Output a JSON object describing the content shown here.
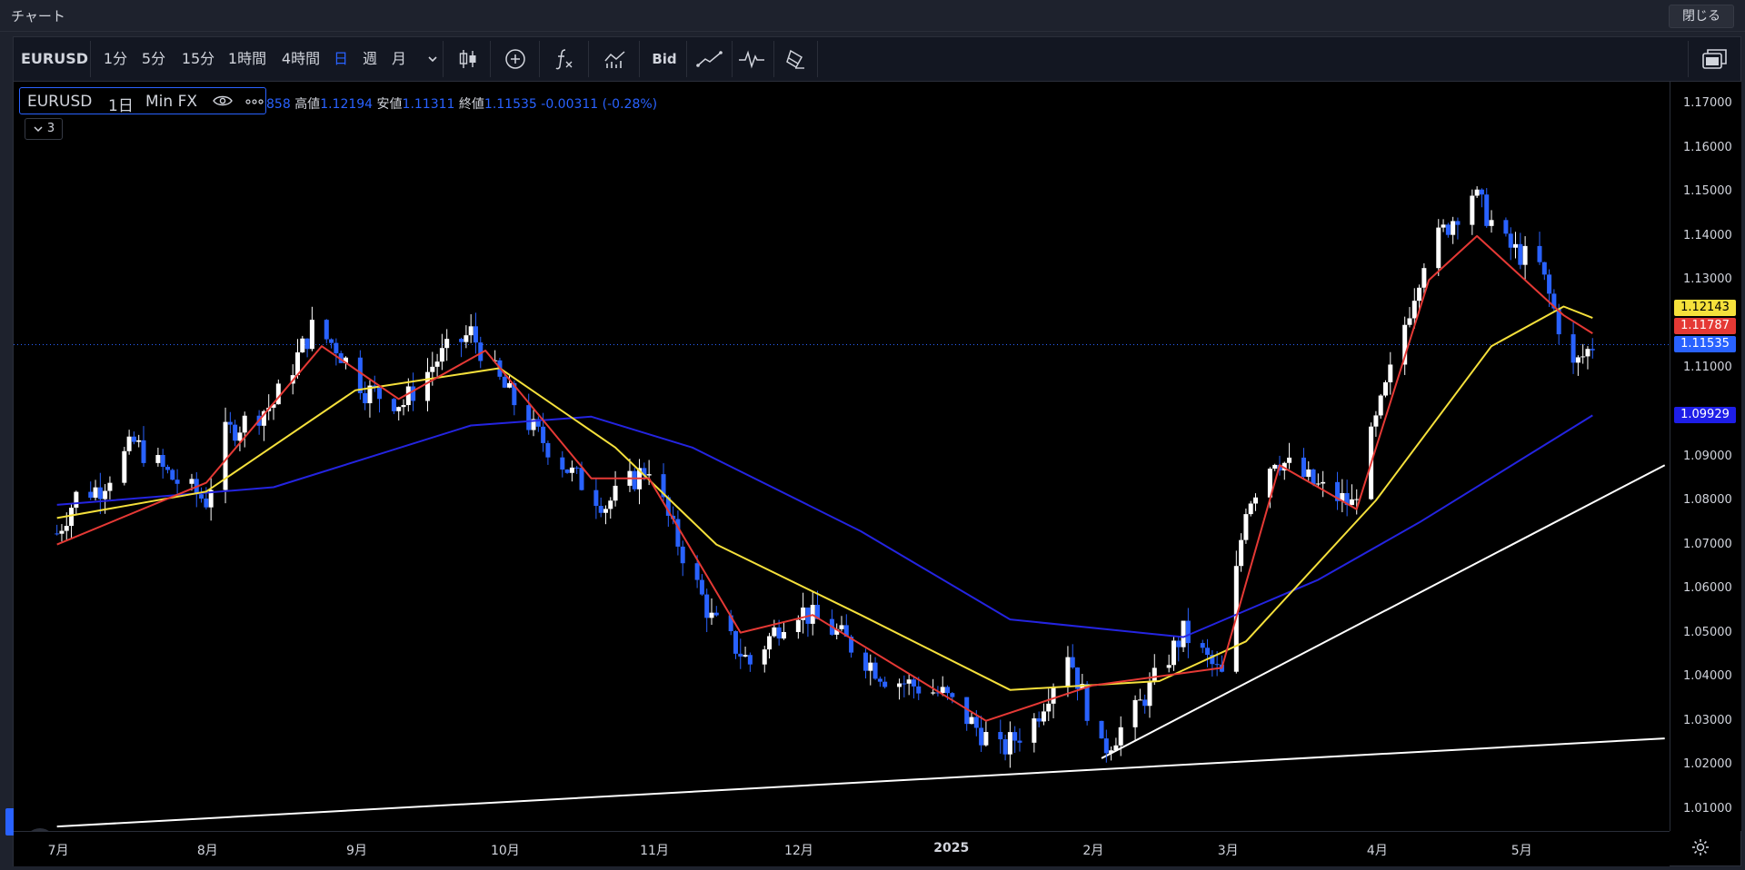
{
  "window": {
    "title": "チャート",
    "close_label": "閉じる"
  },
  "toolbar": {
    "symbol": "EURUSD",
    "intervals": [
      "1分",
      "5分",
      "15分",
      "1時間",
      "4時間",
      "日",
      "週",
      "月"
    ],
    "active_interval": "日",
    "bid_label": "Bid"
  },
  "legend": {
    "symbol": "EURUSD",
    "interval": "1日",
    "source": "Min FX",
    "open_partial": "858",
    "high_label": "高値",
    "high": "1.12194",
    "low_label": "安値",
    "low": "1.11311",
    "close_label": "終値",
    "close": "1.11535",
    "change": "-0.00311 (-0.28%)",
    "indicators_toggle": "3"
  },
  "price_axis": {
    "labels": [
      "1.17000",
      "1.16000",
      "1.15000",
      "1.14000",
      "1.13000",
      "1.11000",
      "1.09000",
      "1.08000",
      "1.07000",
      "1.06000",
      "1.05000",
      "1.04000",
      "1.03000",
      "1.02000",
      "1.01000"
    ],
    "tags": [
      {
        "value": "1.12143",
        "bg": "#f5e03b",
        "fg": "#000000"
      },
      {
        "value": "1.11787",
        "bg": "#e53935",
        "fg": "#ffffff"
      },
      {
        "value": "1.11535",
        "bg": "#2962ff",
        "fg": "#ffffff"
      },
      {
        "value": "1.09929",
        "bg": "#1e1ee8",
        "fg": "#ffffff"
      }
    ]
  },
  "time_axis": {
    "labels": [
      "7月",
      "8月",
      "9月",
      "10月",
      "11月",
      "12月",
      "2025",
      "2月",
      "3月",
      "4月",
      "5月"
    ]
  },
  "colors": {
    "up": "#ffffff",
    "down": "#2962ff",
    "ma_fast": "#e53935",
    "ma_mid": "#f5e03b",
    "ma_slow": "#2424e0",
    "trendline": "#ffffff"
  },
  "chart_data": {
    "type": "line",
    "price_range": [
      1.005,
      1.175
    ],
    "close_path": [
      [
        "2024-07-01",
        1.0725
      ],
      [
        "2024-07-05",
        1.081
      ],
      [
        "2024-07-10",
        1.083
      ],
      [
        "2024-07-17",
        1.093
      ],
      [
        "2024-07-25",
        1.085
      ],
      [
        "2024-08-01",
        1.08
      ],
      [
        "2024-08-05",
        1.095
      ],
      [
        "2024-08-15",
        1.102
      ],
      [
        "2024-08-23",
        1.119
      ],
      [
        "2024-08-28",
        1.115
      ],
      [
        "2024-09-03",
        1.105
      ],
      [
        "2024-09-11",
        1.102
      ],
      [
        "2024-09-18",
        1.112
      ],
      [
        "2024-09-25",
        1.118
      ],
      [
        "2024-10-01",
        1.107
      ],
      [
        "2024-10-08",
        1.096
      ],
      [
        "2024-10-16",
        1.086
      ],
      [
        "2024-10-23",
        1.079
      ],
      [
        "2024-11-01",
        1.088
      ],
      [
        "2024-11-06",
        1.073
      ],
      [
        "2024-11-14",
        1.053
      ],
      [
        "2024-11-22",
        1.043
      ],
      [
        "2024-12-01",
        1.056
      ],
      [
        "2024-12-10",
        1.05
      ],
      [
        "2024-12-20",
        1.04
      ],
      [
        "2025-01-01",
        1.036
      ],
      [
        "2025-01-13",
        1.023
      ],
      [
        "2025-01-20",
        1.03
      ],
      [
        "2025-01-27",
        1.046
      ],
      [
        "2025-02-03",
        1.023
      ],
      [
        "2025-02-10",
        1.032
      ],
      [
        "2025-02-20",
        1.05
      ],
      [
        "2025-02-28",
        1.04
      ],
      [
        "2025-03-05",
        1.079
      ],
      [
        "2025-03-11",
        1.09
      ],
      [
        "2025-03-20",
        1.083
      ],
      [
        "2025-03-27",
        1.079
      ],
      [
        "2025-04-03",
        1.105
      ],
      [
        "2025-04-11",
        1.135
      ],
      [
        "2025-04-21",
        1.15
      ],
      [
        "2025-04-28",
        1.138
      ],
      [
        "2025-05-05",
        1.133
      ],
      [
        "2025-05-12",
        1.11
      ],
      [
        "2025-05-16",
        1.1153
      ]
    ],
    "ma_fast": [
      [
        "2024-07-01",
        1.07
      ],
      [
        "2024-08-01",
        1.084
      ],
      [
        "2024-08-25",
        1.115
      ],
      [
        "2024-09-10",
        1.103
      ],
      [
        "2024-09-28",
        1.114
      ],
      [
        "2024-10-20",
        1.085
      ],
      [
        "2024-11-01",
        1.085
      ],
      [
        "2024-11-20",
        1.05
      ],
      [
        "2024-12-05",
        1.054
      ],
      [
        "2025-01-10",
        1.03
      ],
      [
        "2025-02-01",
        1.038
      ],
      [
        "2025-02-28",
        1.042
      ],
      [
        "2025-03-12",
        1.088
      ],
      [
        "2025-03-28",
        1.078
      ],
      [
        "2025-04-12",
        1.13
      ],
      [
        "2025-04-22",
        1.14
      ],
      [
        "2025-05-10",
        1.122
      ],
      [
        "2025-05-16",
        1.1179
      ]
    ],
    "ma_mid": [
      [
        "2024-07-01",
        1.076
      ],
      [
        "2024-08-01",
        1.082
      ],
      [
        "2024-09-01",
        1.105
      ],
      [
        "2024-10-01",
        1.11
      ],
      [
        "2024-10-25",
        1.092
      ],
      [
        "2024-11-15",
        1.07
      ],
      [
        "2024-12-15",
        1.054
      ],
      [
        "2025-01-15",
        1.037
      ],
      [
        "2025-02-15",
        1.039
      ],
      [
        "2025-03-05",
        1.048
      ],
      [
        "2025-04-01",
        1.08
      ],
      [
        "2025-04-25",
        1.115
      ],
      [
        "2025-05-10",
        1.124
      ],
      [
        "2025-05-16",
        1.1214
      ]
    ],
    "ma_slow": [
      [
        "2024-07-01",
        1.079
      ],
      [
        "2024-08-15",
        1.083
      ],
      [
        "2024-09-25",
        1.097
      ],
      [
        "2024-10-20",
        1.099
      ],
      [
        "2024-11-10",
        1.092
      ],
      [
        "2024-12-15",
        1.073
      ],
      [
        "2025-01-15",
        1.053
      ],
      [
        "2025-02-20",
        1.049
      ],
      [
        "2025-03-20",
        1.062
      ],
      [
        "2025-04-10",
        1.075
      ],
      [
        "2025-05-16",
        1.0993
      ]
    ],
    "trendlines": [
      {
        "from": [
          "2024-07-01",
          1.006
        ],
        "to": [
          "2025-05-31",
          1.026
        ]
      },
      {
        "from": [
          "2025-02-03",
          1.0215
        ],
        "to": [
          "2025-05-31",
          1.088
        ]
      }
    ]
  }
}
